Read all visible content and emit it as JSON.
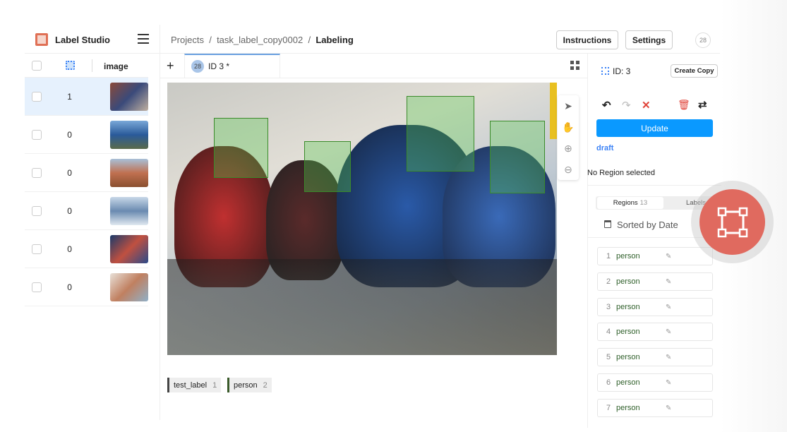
{
  "app": {
    "brand": "Label Studio"
  },
  "breadcrumb": {
    "projects": "Projects",
    "sep": "/",
    "project": "task_label_copy0002",
    "page": "Labeling"
  },
  "header": {
    "instructions": "Instructions",
    "settings": "Settings",
    "user_avatar": "28"
  },
  "task_list": {
    "column_image": "image",
    "rows": [
      {
        "count": "1",
        "selected": true
      },
      {
        "count": "0"
      },
      {
        "count": "0"
      },
      {
        "count": "0"
      },
      {
        "count": "0"
      },
      {
        "count": "0"
      }
    ]
  },
  "tabs": {
    "add": "+",
    "avatar": "28",
    "label": "ID 3 *"
  },
  "bottom_labels": [
    {
      "name": "test_label",
      "hotkey": "1",
      "color": "#444444"
    },
    {
      "name": "person",
      "hotkey": "2",
      "color": "#3a5a2a"
    }
  ],
  "side": {
    "id": "ID: 3",
    "create_copy": "Create Copy",
    "update": "Update",
    "status": "draft",
    "no_region": "No Region selected",
    "regions_tab": "Regions",
    "regions_count": "13",
    "labels_tab": "Labels",
    "sorted": "Sorted by Date",
    "regions": [
      {
        "i": "1",
        "label": "person"
      },
      {
        "i": "2",
        "label": "person"
      },
      {
        "i": "3",
        "label": "person"
      },
      {
        "i": "4",
        "label": "person"
      },
      {
        "i": "5",
        "label": "person"
      },
      {
        "i": "6",
        "label": "person"
      },
      {
        "i": "7",
        "label": "person"
      }
    ]
  },
  "colors": {
    "accent": "#0a99ff",
    "bbox": "#5ac850",
    "overlay_circle": "#e06a5f"
  }
}
